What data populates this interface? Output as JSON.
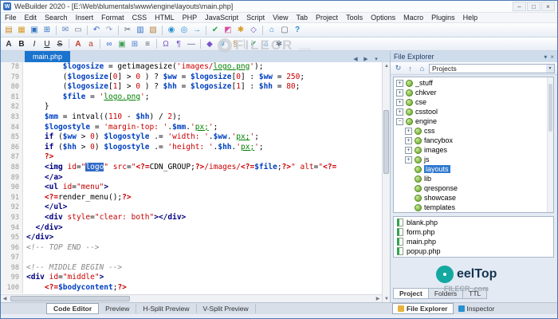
{
  "window": {
    "app_icon": "W",
    "title": "WeBuilder 2020 - [E:\\Web\\blumentals\\www\\engine\\layouts\\main.php]",
    "controls": [
      {
        "n": "minimize",
        "g": "–"
      },
      {
        "n": "maximize",
        "g": "□"
      },
      {
        "n": "close",
        "g": "×"
      }
    ]
  },
  "scroll": {
    "up": "▲",
    "down": "▼",
    "left": "◀",
    "right": "▶"
  },
  "menu": [
    "File",
    "Edit",
    "Search",
    "Insert",
    "Format",
    "CSS",
    "HTML",
    "PHP",
    "JavaScript",
    "Script",
    "View",
    "Tab",
    "Project",
    "Tools",
    "Options",
    "Macro",
    "Plugins",
    "Help"
  ],
  "toolbar1": [
    {
      "n": "new-file",
      "g": "▤",
      "c": "#c9891f"
    },
    {
      "n": "open-file",
      "g": "▦",
      "c": "#d89b22"
    },
    {
      "n": "save",
      "g": "▣",
      "c": "#2f6fc0"
    },
    {
      "n": "save-all",
      "g": "⊞",
      "c": "#2f6fc0"
    },
    "|",
    {
      "n": "email",
      "g": "✉",
      "c": "#5b7fb9"
    },
    {
      "n": "print",
      "g": "▭",
      "c": "#6a7686"
    },
    "|",
    {
      "n": "undo",
      "g": "↶",
      "c": "#2e64c8"
    },
    {
      "n": "redo",
      "g": "↷",
      "c": "#8fa2bd"
    },
    "|",
    {
      "n": "cut",
      "g": "✂",
      "c": "#55606e"
    },
    {
      "n": "copy",
      "g": "▥",
      "c": "#2f6fc0"
    },
    {
      "n": "paste",
      "g": "▧",
      "c": "#b5803a"
    },
    "|",
    {
      "n": "find",
      "g": "◉",
      "c": "#2a8fd0"
    },
    {
      "n": "find-replace",
      "g": "◎",
      "c": "#2a8fd0"
    },
    {
      "n": "goto-line",
      "g": "→",
      "c": "#2a8fd0"
    },
    "|",
    {
      "n": "syntax-check",
      "g": "✔",
      "c": "#2da44e"
    },
    {
      "n": "color-picker",
      "g": "◩",
      "c": "#d84f9a"
    },
    {
      "n": "code-snippets",
      "g": "✱",
      "c": "#d89b22"
    },
    {
      "n": "tag-inspector",
      "g": "◇",
      "c": "#7a52c8"
    },
    "|",
    {
      "n": "preview-in-browser",
      "g": "⌂",
      "c": "#2a8fd0"
    },
    {
      "n": "fullscreen",
      "g": "▢",
      "c": "#55606e"
    },
    {
      "n": "help",
      "g": "?",
      "c": "#2a8fd0",
      "st": "b"
    }
  ],
  "toolbar2": [
    {
      "n": "font",
      "g": "A",
      "c": "#333333",
      "st": "b"
    },
    {
      "n": "bold",
      "g": "B",
      "c": "#222222",
      "st": "b"
    },
    {
      "n": "italic",
      "g": "I",
      "c": "#222222",
      "st": "i"
    },
    {
      "n": "underline",
      "g": "U",
      "c": "#222222",
      "st": "u"
    },
    {
      "n": "strikethrough",
      "g": "S",
      "c": "#222222",
      "st": "s"
    },
    "|",
    {
      "n": "font-increase",
      "g": "A",
      "c": "#c0392b",
      "st": "b"
    },
    {
      "n": "font-decrease",
      "g": "a",
      "c": "#c0392b"
    },
    "|",
    {
      "n": "hyperlink",
      "g": "∞",
      "c": "#2a64c8"
    },
    {
      "n": "insert-image",
      "g": "▣",
      "c": "#3f9e53"
    },
    {
      "n": "insert-table",
      "g": "⊞",
      "c": "#4a7fd4"
    },
    {
      "n": "insert-list",
      "g": "≡",
      "c": "#55606e"
    },
    "|",
    {
      "n": "special-char",
      "g": "Ω",
      "c": "#7a52c8"
    },
    {
      "n": "paragraph",
      "g": "¶",
      "c": "#7a52c8"
    },
    {
      "n": "horizontal-rule",
      "g": "―",
      "c": "#55606e"
    },
    "|",
    {
      "n": "php-tag",
      "g": "◆",
      "c": "#7a52c8"
    },
    {
      "n": "css-style",
      "g": "#",
      "c": "#2a8fd0",
      "st": "b"
    },
    {
      "n": "script-tag",
      "g": "§",
      "c": "#b5803a"
    },
    "|",
    {
      "n": "validate",
      "g": "✔",
      "c": "#2da44e"
    },
    {
      "n": "open-in-browser",
      "g": "⌂",
      "c": "#2a8fd0"
    },
    {
      "n": "settings",
      "g": "✱",
      "c": "#6a7686"
    }
  ],
  "tabstrip": {
    "tab": "main.php",
    "nav": [
      {
        "n": "tab-scroll-left",
        "g": "◀"
      },
      {
        "n": "tab-scroll-right",
        "g": "▶"
      },
      {
        "n": "tab-list",
        "g": "▾"
      }
    ]
  },
  "editor": {
    "lines": [
      {
        "n": 78,
        "t": [
          [
            "pl",
            "        "
          ],
          [
            "v",
            "$logosize"
          ],
          [
            "pl",
            " = getimagesize("
          ],
          [
            "s",
            "'images/"
          ],
          [
            "g",
            "logo.png"
          ],
          [
            "s",
            "'"
          ],
          [
            "pl",
            ");"
          ]
        ]
      },
      {
        "n": 79,
        "t": [
          [
            "pl",
            "        ("
          ],
          [
            "v",
            "$logosize"
          ],
          [
            "pl",
            "["
          ],
          [
            "n",
            "0"
          ],
          [
            "pl",
            "] > "
          ],
          [
            "n",
            "0"
          ],
          [
            "pl",
            " ) ? "
          ],
          [
            "v",
            "$ww"
          ],
          [
            "pl",
            " = "
          ],
          [
            "v",
            "$logosize"
          ],
          [
            "pl",
            "["
          ],
          [
            "n",
            "0"
          ],
          [
            "pl",
            "] : "
          ],
          [
            "v",
            "$ww"
          ],
          [
            "pl",
            " = "
          ],
          [
            "n",
            "250"
          ],
          [
            "pl",
            ";"
          ]
        ]
      },
      {
        "n": 80,
        "t": [
          [
            "pl",
            "        ("
          ],
          [
            "v",
            "$logosize"
          ],
          [
            "pl",
            "["
          ],
          [
            "n",
            "1"
          ],
          [
            "pl",
            "] > "
          ],
          [
            "n",
            "0"
          ],
          [
            "pl",
            " ) ? "
          ],
          [
            "v",
            "$hh"
          ],
          [
            "pl",
            " = "
          ],
          [
            "v",
            "$logosize"
          ],
          [
            "pl",
            "["
          ],
          [
            "n",
            "1"
          ],
          [
            "pl",
            "] : "
          ],
          [
            "v",
            "$hh"
          ],
          [
            "pl",
            " = "
          ],
          [
            "n",
            "80"
          ],
          [
            "pl",
            ";"
          ]
        ]
      },
      {
        "n": 81,
        "t": [
          [
            "pl",
            "        "
          ],
          [
            "v",
            "$file"
          ],
          [
            "pl",
            " = "
          ],
          [
            "s",
            "'"
          ],
          [
            "g",
            "logo.png"
          ],
          [
            "s",
            "'"
          ],
          [
            "pl",
            ";"
          ]
        ]
      },
      {
        "n": 82,
        "t": [
          [
            "pl",
            "    }"
          ]
        ]
      },
      {
        "n": 83,
        "t": [
          [
            "pl",
            "    "
          ],
          [
            "v",
            "$mm"
          ],
          [
            "pl",
            " = intval(("
          ],
          [
            "n",
            "110"
          ],
          [
            "pl",
            " - "
          ],
          [
            "v",
            "$hh"
          ],
          [
            "pl",
            ") / "
          ],
          [
            "n",
            "2"
          ],
          [
            "pl",
            ");"
          ]
        ]
      },
      {
        "n": 84,
        "t": [
          [
            "pl",
            "    "
          ],
          [
            "v",
            "$logostyle"
          ],
          [
            "pl",
            " = "
          ],
          [
            "s",
            "'margin-top: '"
          ],
          [
            "pl",
            "."
          ],
          [
            "v",
            "$mm"
          ],
          [
            "pl",
            "."
          ],
          [
            "s",
            "'"
          ],
          [
            "g",
            "px;"
          ],
          [
            "s",
            "'"
          ],
          [
            "pl",
            ";"
          ]
        ]
      },
      {
        "n": 85,
        "t": [
          [
            "pl",
            "    "
          ],
          [
            "k",
            "if"
          ],
          [
            "pl",
            " ("
          ],
          [
            "v",
            "$ww"
          ],
          [
            "pl",
            " > "
          ],
          [
            "n",
            "0"
          ],
          [
            "pl",
            ") "
          ],
          [
            "v",
            "$logostyle"
          ],
          [
            "pl",
            " .= "
          ],
          [
            "s",
            "'width: '"
          ],
          [
            "pl",
            "."
          ],
          [
            "v",
            "$ww"
          ],
          [
            "pl",
            "."
          ],
          [
            "s",
            "'"
          ],
          [
            "g",
            "px;"
          ],
          [
            "s",
            "'"
          ],
          [
            "pl",
            ";"
          ]
        ]
      },
      {
        "n": 86,
        "t": [
          [
            "pl",
            "    "
          ],
          [
            "k",
            "if"
          ],
          [
            "pl",
            " ("
          ],
          [
            "v",
            "$hh"
          ],
          [
            "pl",
            " > "
          ],
          [
            "n",
            "0"
          ],
          [
            "pl",
            ") "
          ],
          [
            "v",
            "$logostyle"
          ],
          [
            "pl",
            " .= "
          ],
          [
            "s",
            "'height: '"
          ],
          [
            "pl",
            "."
          ],
          [
            "v",
            "$hh"
          ],
          [
            "pl",
            "."
          ],
          [
            "s",
            "'"
          ],
          [
            "g",
            "px;"
          ],
          [
            "s",
            "'"
          ],
          [
            "pl",
            ";"
          ]
        ]
      },
      {
        "n": 87,
        "t": [
          [
            "pl",
            "    "
          ],
          [
            "p",
            "?>"
          ]
        ]
      },
      {
        "n": 88,
        "t": [
          [
            "pl",
            "    "
          ],
          [
            "t",
            "<img"
          ],
          [
            "pl",
            " "
          ],
          [
            "a",
            "id"
          ],
          [
            "pl",
            "="
          ],
          [
            "s",
            "\""
          ],
          [
            "sel",
            "logo"
          ],
          [
            "s",
            "\""
          ],
          [
            "pl",
            " "
          ],
          [
            "a",
            "src"
          ],
          [
            "pl",
            "="
          ],
          [
            "s",
            "\""
          ],
          [
            "p",
            "<?="
          ],
          [
            "pl",
            "CDN_GROUP;"
          ],
          [
            "p",
            "?>"
          ],
          [
            "s",
            "/images/"
          ],
          [
            "p",
            "<?="
          ],
          [
            "v",
            "$file"
          ],
          [
            "pl",
            ";"
          ],
          [
            "p",
            "?>"
          ],
          [
            "s",
            "\""
          ],
          [
            "pl",
            " "
          ],
          [
            "a",
            "alt"
          ],
          [
            "pl",
            "="
          ],
          [
            "s",
            "\""
          ],
          [
            "p",
            "<?="
          ]
        ]
      },
      {
        "n": 89,
        "t": [
          [
            "pl",
            "    "
          ],
          [
            "t",
            "</a>"
          ]
        ]
      },
      {
        "n": 90,
        "t": [
          [
            "pl",
            "    "
          ],
          [
            "t",
            "<ul"
          ],
          [
            "pl",
            " "
          ],
          [
            "a",
            "id"
          ],
          [
            "pl",
            "="
          ],
          [
            "s",
            "\"menu\""
          ],
          [
            "t",
            ">"
          ]
        ]
      },
      {
        "n": 91,
        "t": [
          [
            "pl",
            "    "
          ],
          [
            "p",
            "<?="
          ],
          [
            "pl",
            "render_menu();"
          ],
          [
            "p",
            "?>"
          ]
        ]
      },
      {
        "n": 92,
        "t": [
          [
            "pl",
            "    "
          ],
          [
            "t",
            "</ul>"
          ]
        ]
      },
      {
        "n": 93,
        "t": [
          [
            "pl",
            "    "
          ],
          [
            "t",
            "<div"
          ],
          [
            "pl",
            " "
          ],
          [
            "a",
            "style"
          ],
          [
            "pl",
            "="
          ],
          [
            "s",
            "\"clear: both\""
          ],
          [
            "t",
            ">"
          ],
          [
            "t",
            "</div>"
          ]
        ]
      },
      {
        "n": 94,
        "t": [
          [
            "pl",
            "  "
          ],
          [
            "t",
            "</div>"
          ]
        ]
      },
      {
        "n": 95,
        "t": [
          [
            "t",
            "</div>"
          ]
        ]
      },
      {
        "n": 96,
        "t": [
          [
            "c",
            "<!-- TOP END -->"
          ]
        ]
      },
      {
        "n": 97,
        "t": []
      },
      {
        "n": 98,
        "t": [
          [
            "c",
            "<!-- MIDDLE BEGIN -->"
          ]
        ]
      },
      {
        "n": 99,
        "t": [
          [
            "t",
            "<div"
          ],
          [
            "pl",
            " "
          ],
          [
            "a",
            "id"
          ],
          [
            "pl",
            "="
          ],
          [
            "s",
            "\"middle\""
          ],
          [
            "t",
            ">"
          ]
        ]
      },
      {
        "n": 100,
        "t": [
          [
            "pl",
            "    "
          ],
          [
            "p",
            "<?="
          ],
          [
            "v",
            "$bodycontent"
          ],
          [
            "pl",
            ";"
          ],
          [
            "p",
            "?>"
          ]
        ]
      }
    ]
  },
  "bottom_tabs": {
    "items": [
      "Code Editor",
      "Preview",
      "H-Split Preview",
      "V-Split Preview"
    ],
    "active": 0
  },
  "explorer": {
    "title": "File Explorer",
    "header_icons": [
      {
        "n": "panel-menu",
        "g": "▾"
      },
      {
        "n": "panel-close",
        "g": "×"
      }
    ],
    "toolbar_icons": [
      {
        "n": "refresh",
        "g": "↻"
      },
      {
        "n": "folder-up",
        "g": "↑"
      },
      {
        "n": "home",
        "g": "⌂"
      }
    ],
    "combo": "Projects",
    "combo_arrow": "▾",
    "tree": [
      {
        "l": "_stuff",
        "lv": 1,
        "e": "+"
      },
      {
        "l": "chkver",
        "lv": 1,
        "e": "+"
      },
      {
        "l": "cse",
        "lv": 1,
        "e": "+"
      },
      {
        "l": "csstool",
        "lv": 1,
        "e": "+"
      },
      {
        "l": "engine",
        "lv": 1,
        "e": "−"
      },
      {
        "l": "css",
        "lv": 2,
        "e": "+"
      },
      {
        "l": "fancybox",
        "lv": 2,
        "e": "+"
      },
      {
        "l": "images",
        "lv": 2,
        "e": "+"
      },
      {
        "l": "js",
        "lv": 2,
        "e": "+"
      },
      {
        "l": "layouts",
        "lv": 2,
        "sel": true
      },
      {
        "l": "lib",
        "lv": 2
      },
      {
        "l": "qresponse",
        "lv": 2
      },
      {
        "l": "showcase",
        "lv": 2
      },
      {
        "l": "templates",
        "lv": 2
      }
    ],
    "files": [
      "blank.php",
      "form.php",
      "main.php",
      "popup.php"
    ],
    "proj_tabs": {
      "items": [
        "Project",
        "Folders",
        "TTL"
      ],
      "active": 0
    },
    "panel_tabs": {
      "items": [
        {
          "label": "File Explorer",
          "c": "#e8b33d"
        },
        {
          "label": "Inspector",
          "c": "#2a8fd0"
        }
      ],
      "active": 0
    }
  },
  "watermark": {
    "center": "FILECR",
    "center_sub": ".com",
    "logo_text": "eelTop",
    "logo_sub": "FILECR .com"
  }
}
